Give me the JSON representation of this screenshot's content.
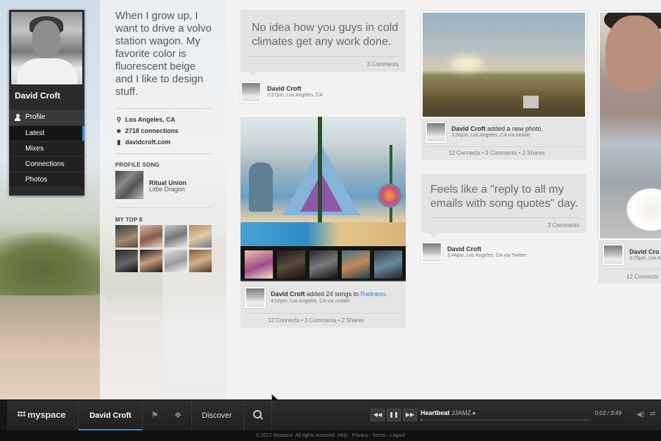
{
  "profile": {
    "name": "David Croft",
    "nav": [
      {
        "label": "Profile"
      },
      {
        "label": "Latest"
      },
      {
        "label": "Mixes"
      },
      {
        "label": "Connections"
      },
      {
        "label": "Photos"
      }
    ]
  },
  "bio": {
    "quote": "When I grow up, I want to drive a volvo station wagon. My favorite color is fluorescent beige and I like to design stuff.",
    "location": "Los Angeles, CA",
    "connections": "2718 connections",
    "website": "davidcroft.com",
    "profile_song_label": "PROFILE SONG",
    "song_title": "Ritual Union",
    "song_artist": "Little Dragon",
    "top8_label": "MY TOP 8"
  },
  "feed": {
    "post1": {
      "text": "No idea how you guys in cold climates get any work done.",
      "comments": "3 Comments",
      "author": "David Croft",
      "meta": "2:57pm, Los Angeles, CA"
    },
    "post2": {
      "author": "David Croft",
      "action": "added 24 songs to",
      "target": "Radness",
      "target_suffix": ".",
      "meta": "4:02pm, Los Angeles, CA via mobile",
      "footer": "12 Connects  •  3 Comments  •  2 Shares"
    },
    "post3": {
      "author": "David Croft",
      "action": "added a new photo.",
      "meta": "3:56pm, Los Angeles, CA via mobile",
      "footer": "12 Connects  •  3 Comments  •  2 Shares"
    },
    "post4": {
      "text": "Feels like a \"reply to all my emails with song quotes\" day.",
      "comments": "3 Comments",
      "author": "David Croft",
      "meta": "3:44pm, Los Angeles, CA via Twitter"
    },
    "post5": {
      "author": "David Cro",
      "meta": "3:05pm, Los A",
      "footer": "12 Connects"
    }
  },
  "bottombar": {
    "logo": "myspace",
    "user": "David Croft",
    "discover": "Discover",
    "track_title": "Heartbeat",
    "track_artist": "JJAMZ",
    "time": "0:02 / 3:49",
    "progress_fraction": 0.01
  },
  "footer": {
    "text": "© 2012 Myspace. All rights reserved. Help · Privacy · Terms · Logout"
  },
  "colors": {
    "accent": "#2c8de0",
    "bar_bg": "#262626",
    "bubble_bg": "#e3e3e3"
  },
  "icons": {
    "location": "map-pin-icon",
    "connections": "people-icon",
    "website": "bookmark-icon",
    "flag": "flag-icon",
    "chat": "chat-icon",
    "search": "search-icon",
    "prev": "previous-icon",
    "pause": "pause-icon",
    "next": "next-icon",
    "volume": "volume-icon",
    "shuffle": "shuffle-icon"
  }
}
